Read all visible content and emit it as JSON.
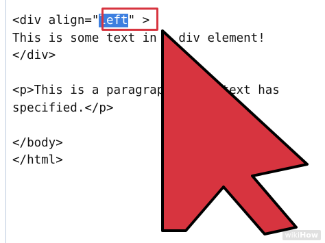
{
  "editor": {
    "lines": [
      {
        "prefix": "<div align=\"",
        "selected": "left",
        "suffix": "\" >"
      },
      {
        "prefix": "This is some text in a div element!",
        "selected": "",
        "suffix": ""
      },
      {
        "prefix": "</div>",
        "selected": "",
        "suffix": ""
      },
      {
        "prefix": "",
        "selected": "",
        "suffix": ""
      },
      {
        "prefix": "<p>This is a paragraph. This text has",
        "selected": "",
        "suffix": ""
      },
      {
        "prefix": "specified.</p>",
        "selected": "",
        "suffix": ""
      },
      {
        "prefix": "",
        "selected": "",
        "suffix": ""
      },
      {
        "prefix": "</body>",
        "selected": "",
        "suffix": ""
      },
      {
        "prefix": "</html>",
        "selected": "",
        "suffix": ""
      }
    ]
  },
  "overlay": {
    "arrow_icon": "mouse-pointer-arrow-icon",
    "arrow_color": "#d7343f",
    "box_color": "#d7343f",
    "selection_color": "#3d7fe0"
  },
  "watermark": {
    "wiki": "wiki",
    "how": "How"
  }
}
